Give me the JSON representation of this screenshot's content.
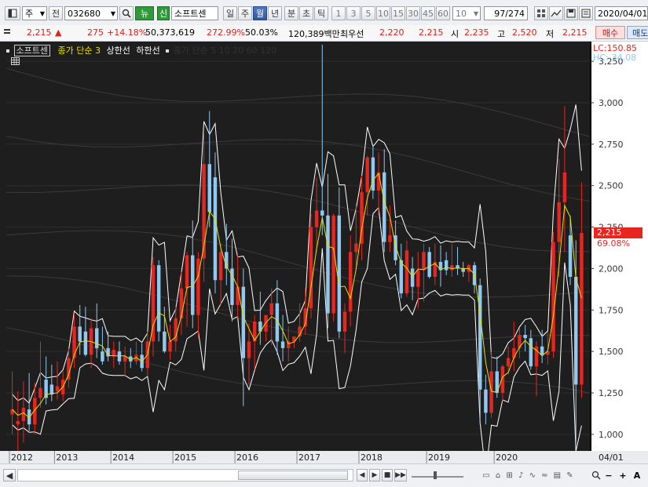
{
  "toolbar": {
    "period_select": "주",
    "all_button": "전",
    "code": "032680",
    "news_button": "뉴",
    "new_button": "신",
    "stock_name": "소프트센",
    "periods": [
      "일",
      "주",
      "월",
      "년"
    ],
    "period_active": "월",
    "minutes": [
      "분",
      "초",
      "틱"
    ],
    "numbers": [
      "1",
      "3",
      "5",
      "10",
      "15",
      "30",
      "45",
      "60"
    ],
    "count_value": "10",
    "page": "97",
    "page_total": "/274",
    "date": "2020/04/01"
  },
  "quote": {
    "price": "2,215",
    "up_arrow": "▲",
    "change": "275",
    "change_pct": "+14.18%",
    "volume": "50,373,619",
    "volume_ratio": "272.99%",
    "ratio2": "50.03%",
    "amount": "120,389백만",
    "best_bid_label": "최우선",
    "best_bid_value": "2,220",
    "best_ask_value": "2,215",
    "open_label": "시",
    "open_value": "2,235",
    "high_label": "고",
    "high_value": "2,520",
    "low_label": "저",
    "low_value": "2,215",
    "buy_button": "매수",
    "sell_button": "매도"
  },
  "chart_header": {
    "stock_name": "소프트센",
    "ma_label": "종가 단순 3",
    "upper_label": "상한선",
    "lower_label": "하한선",
    "extra_label": "종가 단순 5 10 20 60 120"
  },
  "chart_data": {
    "type": "candlestick",
    "y_ticks": [
      "3,250",
      "3,000",
      "2,750",
      "2,500",
      "2,250",
      "2,000",
      "1,750",
      "1,500",
      "1,250",
      "1,000"
    ],
    "ylim": [
      900,
      3350
    ],
    "x_labels": [
      "2012",
      "2013",
      "2014",
      "2015",
      "2016",
      "2017",
      "2018",
      "2019",
      "2020"
    ],
    "x_end_label": "04/01",
    "current_price_label": "2,215",
    "current_pct_label": "69.08%",
    "lc_label": "LC:150.85",
    "hc_label": "HC:-34.08",
    "colors": {
      "up": "#e8251f",
      "down": "#8fc8f0",
      "ma": "#e8e000",
      "band": "#ffffff"
    },
    "candles": [
      {
        "o": 1120,
        "h": 1380,
        "l": 1000,
        "c": 1150
      },
      {
        "o": 1060,
        "h": 1260,
        "l": 900,
        "c": 1080
      },
      {
        "o": 1080,
        "h": 1320,
        "l": 950,
        "c": 1160
      },
      {
        "o": 1150,
        "h": 1370,
        "l": 1020,
        "c": 1060
      },
      {
        "o": 1060,
        "h": 1310,
        "l": 1000,
        "c": 1220
      },
      {
        "o": 1220,
        "h": 1560,
        "l": 1160,
        "c": 1280
      },
      {
        "o": 1330,
        "h": 1470,
        "l": 1180,
        "c": 1220
      },
      {
        "o": 1300,
        "h": 1420,
        "l": 1200,
        "c": 1240
      },
      {
        "o": 1260,
        "h": 1440,
        "l": 1210,
        "c": 1290
      },
      {
        "o": 1240,
        "h": 1380,
        "l": 1200,
        "c": 1330
      },
      {
        "o": 1330,
        "h": 1520,
        "l": 1280,
        "c": 1460
      },
      {
        "o": 1460,
        "h": 1730,
        "l": 1400,
        "c": 1650
      },
      {
        "o": 1650,
        "h": 1780,
        "l": 1480,
        "c": 1560
      },
      {
        "o": 1620,
        "h": 1770,
        "l": 1470,
        "c": 1480
      },
      {
        "o": 1480,
        "h": 1700,
        "l": 1400,
        "c": 1640
      },
      {
        "o": 1640,
        "h": 1790,
        "l": 1460,
        "c": 1520
      },
      {
        "o": 1500,
        "h": 1650,
        "l": 1420,
        "c": 1440
      },
      {
        "o": 1520,
        "h": 1620,
        "l": 1440,
        "c": 1470
      },
      {
        "o": 1470,
        "h": 1560,
        "l": 1400,
        "c": 1510
      },
      {
        "o": 1500,
        "h": 1560,
        "l": 1420,
        "c": 1440
      },
      {
        "o": 1440,
        "h": 1530,
        "l": 1350,
        "c": 1470
      },
      {
        "o": 1470,
        "h": 1520,
        "l": 1400,
        "c": 1440
      },
      {
        "o": 1440,
        "h": 1560,
        "l": 1420,
        "c": 1480
      },
      {
        "o": 1480,
        "h": 1550,
        "l": 1380,
        "c": 1400
      },
      {
        "o": 1400,
        "h": 1620,
        "l": 1350,
        "c": 1560
      },
      {
        "o": 1560,
        "h": 2070,
        "l": 1470,
        "c": 2020
      },
      {
        "o": 2020,
        "h": 2050,
        "l": 1560,
        "c": 1620
      },
      {
        "o": 1620,
        "h": 1770,
        "l": 1490,
        "c": 1500
      },
      {
        "o": 1500,
        "h": 1660,
        "l": 1450,
        "c": 1560
      },
      {
        "o": 1560,
        "h": 1780,
        "l": 1500,
        "c": 1700
      },
      {
        "o": 1700,
        "h": 1980,
        "l": 1600,
        "c": 1880
      },
      {
        "o": 1880,
        "h": 2100,
        "l": 1650,
        "c": 2080
      },
      {
        "o": 2080,
        "h": 2290,
        "l": 1640,
        "c": 1720
      },
      {
        "o": 1720,
        "h": 2100,
        "l": 1580,
        "c": 2060
      },
      {
        "o": 2060,
        "h": 2820,
        "l": 1920,
        "c": 2630
      },
      {
        "o": 2630,
        "h": 2950,
        "l": 2250,
        "c": 2340
      },
      {
        "o": 2550,
        "h": 2700,
        "l": 1850,
        "c": 1930
      },
      {
        "o": 1930,
        "h": 2150,
        "l": 1780,
        "c": 2100
      },
      {
        "o": 2100,
        "h": 2270,
        "l": 1900,
        "c": 2000
      },
      {
        "o": 2000,
        "h": 2180,
        "l": 1680,
        "c": 1780
      },
      {
        "o": 1780,
        "h": 2080,
        "l": 1700,
        "c": 1890
      },
      {
        "o": 1890,
        "h": 2000,
        "l": 1170,
        "c": 1460
      },
      {
        "o": 1460,
        "h": 1670,
        "l": 1300,
        "c": 1560
      },
      {
        "o": 1560,
        "h": 1720,
        "l": 1390,
        "c": 1680
      },
      {
        "o": 1680,
        "h": 1860,
        "l": 1540,
        "c": 1620
      },
      {
        "o": 1620,
        "h": 1700,
        "l": 1560,
        "c": 1720
      },
      {
        "o": 1720,
        "h": 1880,
        "l": 1540,
        "c": 1790
      },
      {
        "o": 1790,
        "h": 1930,
        "l": 1480,
        "c": 1560
      },
      {
        "o": 1560,
        "h": 1720,
        "l": 1440,
        "c": 1520
      },
      {
        "o": 1520,
        "h": 1650,
        "l": 1440,
        "c": 1560
      },
      {
        "o": 1560,
        "h": 1580,
        "l": 1520,
        "c": 1590
      },
      {
        "o": 1590,
        "h": 1790,
        "l": 1560,
        "c": 1650
      },
      {
        "o": 1650,
        "h": 1880,
        "l": 1600,
        "c": 1760
      },
      {
        "o": 1760,
        "h": 2330,
        "l": 1700,
        "c": 2250
      },
      {
        "o": 2250,
        "h": 2550,
        "l": 2100,
        "c": 2350
      },
      {
        "o": 2350,
        "h": 3350,
        "l": 2200,
        "c": 2320
      },
      {
        "o": 2320,
        "h": 2570,
        "l": 1640,
        "c": 1730
      },
      {
        "o": 1730,
        "h": 2330,
        "l": 1680,
        "c": 2320
      },
      {
        "o": 2320,
        "h": 2490,
        "l": 1580,
        "c": 1620
      },
      {
        "o": 1620,
        "h": 1790,
        "l": 1490,
        "c": 1740
      },
      {
        "o": 1740,
        "h": 2200,
        "l": 1650,
        "c": 2100
      },
      {
        "o": 2100,
        "h": 2390,
        "l": 1990,
        "c": 2150
      },
      {
        "o": 2150,
        "h": 2560,
        "l": 2050,
        "c": 2460
      },
      {
        "o": 2460,
        "h": 2680,
        "l": 2320,
        "c": 2670
      },
      {
        "o": 2670,
        "h": 2740,
        "l": 2420,
        "c": 2470
      },
      {
        "o": 2470,
        "h": 2700,
        "l": 2320,
        "c": 2580
      },
      {
        "o": 2580,
        "h": 2720,
        "l": 2100,
        "c": 2160
      },
      {
        "o": 2160,
        "h": 2380,
        "l": 2100,
        "c": 2200
      },
      {
        "o": 2200,
        "h": 2290,
        "l": 2020,
        "c": 2050
      },
      {
        "o": 2050,
        "h": 2150,
        "l": 1820,
        "c": 1850
      },
      {
        "o": 1850,
        "h": 2170,
        "l": 1830,
        "c": 2110
      },
      {
        "o": 2000,
        "h": 2070,
        "l": 1810,
        "c": 1890
      },
      {
        "o": 1890,
        "h": 2100,
        "l": 1760,
        "c": 1990
      },
      {
        "o": 1990,
        "h": 2150,
        "l": 1800,
        "c": 2100
      },
      {
        "o": 2100,
        "h": 2130,
        "l": 1940,
        "c": 1950
      },
      {
        "o": 1950,
        "h": 2150,
        "l": 1900,
        "c": 2040
      },
      {
        "o": 2040,
        "h": 2140,
        "l": 1890,
        "c": 1990
      },
      {
        "o": 2050,
        "h": 2100,
        "l": 1960,
        "c": 1990
      },
      {
        "o": 1990,
        "h": 2150,
        "l": 1950,
        "c": 2020
      },
      {
        "o": 2020,
        "h": 2130,
        "l": 1960,
        "c": 2000
      },
      {
        "o": 2000,
        "h": 2040,
        "l": 1950,
        "c": 1980
      },
      {
        "o": 1980,
        "h": 2030,
        "l": 1920,
        "c": 2020
      },
      {
        "o": 2020,
        "h": 2040,
        "l": 1850,
        "c": 1900
      },
      {
        "o": 1900,
        "h": 1940,
        "l": 1060,
        "c": 1270
      },
      {
        "o": 1270,
        "h": 1360,
        "l": 1060,
        "c": 1130
      },
      {
        "o": 1130,
        "h": 1500,
        "l": 1100,
        "c": 1380
      },
      {
        "o": 1380,
        "h": 1470,
        "l": 1220,
        "c": 1250
      },
      {
        "o": 1250,
        "h": 1420,
        "l": 1200,
        "c": 1410
      },
      {
        "o": 1410,
        "h": 1530,
        "l": 1360,
        "c": 1460
      },
      {
        "o": 1460,
        "h": 1680,
        "l": 1380,
        "c": 1520
      },
      {
        "o": 1520,
        "h": 1640,
        "l": 1460,
        "c": 1600
      },
      {
        "o": 1600,
        "h": 1660,
        "l": 1500,
        "c": 1580
      },
      {
        "o": 1580,
        "h": 1630,
        "l": 1390,
        "c": 1410
      },
      {
        "o": 1410,
        "h": 1560,
        "l": 1230,
        "c": 1530
      },
      {
        "o": 1530,
        "h": 1630,
        "l": 1430,
        "c": 1480
      },
      {
        "o": 1480,
        "h": 1620,
        "l": 1420,
        "c": 1500
      },
      {
        "o": 1500,
        "h": 2220,
        "l": 1460,
        "c": 2160
      },
      {
        "o": 2160,
        "h": 2660,
        "l": 1950,
        "c": 2400
      },
      {
        "o": 2400,
        "h": 2980,
        "l": 2100,
        "c": 2580
      },
      {
        "o": 2200,
        "h": 2320,
        "l": 1900,
        "c": 1950
      },
      {
        "o": 1950,
        "h": 2170,
        "l": 940,
        "c": 1300
      },
      {
        "o": 1300,
        "h": 2520,
        "l": 1220,
        "c": 2215
      }
    ]
  }
}
